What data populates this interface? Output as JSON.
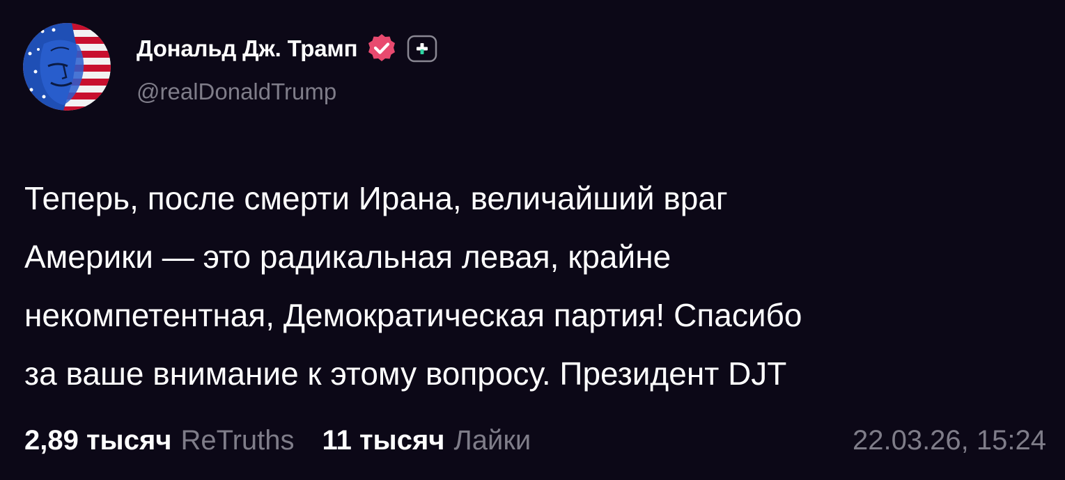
{
  "author": {
    "display_name": "Дональд Дж. Трамп",
    "handle": "@realDonaldTrump",
    "avatar_icon": "flag-portrait-avatar",
    "verified_icon": "verified-badge-icon",
    "follow_icon": "follow-plus-icon"
  },
  "post": {
    "lines": [
      "Теперь, после смерти Ирана, величайший враг",
      "Америки — это радикальная левая, крайне",
      "некомпетентная, Демократическая партия! Спасибо",
      "за ваше внимание к этому вопросу. Президент DJT"
    ]
  },
  "stats": {
    "retruths_count": "2,89 тысяч",
    "retruths_label": "ReTruths",
    "likes_count": "11 тысяч",
    "likes_label": "Лайки"
  },
  "timestamp": "22.03.26, 15:24",
  "colors": {
    "background": "#0c0817",
    "text_primary": "#ffffff",
    "text_muted": "#7f7d89",
    "verified_badge": "#e84a6f",
    "follow_accent": "#2fd6a3"
  }
}
